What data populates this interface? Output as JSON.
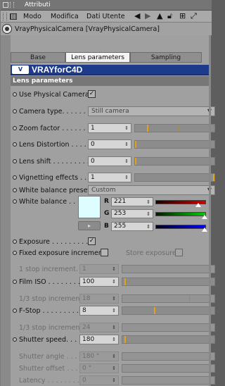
{
  "window": {
    "title": "Attributi"
  },
  "menu": {
    "items": [
      "Modo",
      "Modifica",
      "Dati Utente"
    ]
  },
  "object": {
    "label": "VrayPhysicalCamera [VrayPhysicalCamera]"
  },
  "tabs": [
    {
      "label": "Base",
      "active": false
    },
    {
      "label": "Lens parameters",
      "active": true
    },
    {
      "label": "Sampling",
      "active": false
    }
  ],
  "banner": {
    "logo": "V",
    "brand": "VRAYforC4D"
  },
  "section": {
    "title": "Lens parameters"
  },
  "params": {
    "use_physical_camera": {
      "label": "Use Physical Camera",
      "checked": true
    },
    "camera_type": {
      "label": "Camera type. . . . . . . . .",
      "value": "Still camera"
    },
    "zoom_factor": {
      "label": "Zoom factor . . . . . . . .",
      "value": "1",
      "slider": 0.15
    },
    "lens_distortion": {
      "label": "Lens Distortion . . . . . .",
      "value": "0",
      "slider": 0.0
    },
    "lens_shift": {
      "label": "Lens shift . . . . . . . . .",
      "value": "0",
      "slider": 0.0
    },
    "vignetting": {
      "label": "Vignetting effects . . .",
      "value": "1",
      "slider": 1.0
    },
    "wb_presets": {
      "label": "White balance presets",
      "value": "Custom"
    },
    "white_balance": {
      "label": "White balance . . . .",
      "r": "221",
      "g": "253",
      "b": "255",
      "btn": "▸"
    },
    "exposure": {
      "label": "Exposure . . . . . . . . . .",
      "checked": true
    },
    "fixed_exposure": {
      "label": "Fixed exposure increments",
      "checked": false
    },
    "store_exposure": {
      "label": "Store exposure",
      "checked": false
    },
    "stop_increment_1": {
      "label": "1 stop increment. .",
      "value": "1"
    },
    "film_iso": {
      "label": "Film ISO . . . . . . . . . . .",
      "value": "100",
      "slider": 0.02
    },
    "third_stop_18": {
      "label": "1/3 stop increment",
      "value": "18"
    },
    "f_stop": {
      "label": "F-Stop . . . . . . . . . . . . .",
      "value": "8",
      "slider": 0.35
    },
    "third_stop_24": {
      "label": "1/3 stop increment",
      "value": "24"
    },
    "shutter_speed": {
      "label": "Shutter speed. . . . . . .",
      "value": "180",
      "slider": 0.02
    },
    "shutter_angle": {
      "label": "Shutter angle . . . . . . .",
      "value": "180 °"
    },
    "shutter_offset": {
      "label": "Shutter offset . . . . . . .",
      "value": "0 °"
    },
    "latency": {
      "label": "Latency . . . . . . . . . . .",
      "value": "0"
    }
  },
  "colors": {
    "banner": "#1e3a8a",
    "slider_mark": "#e3a21a",
    "wb_swatch": "#ddfdff"
  }
}
